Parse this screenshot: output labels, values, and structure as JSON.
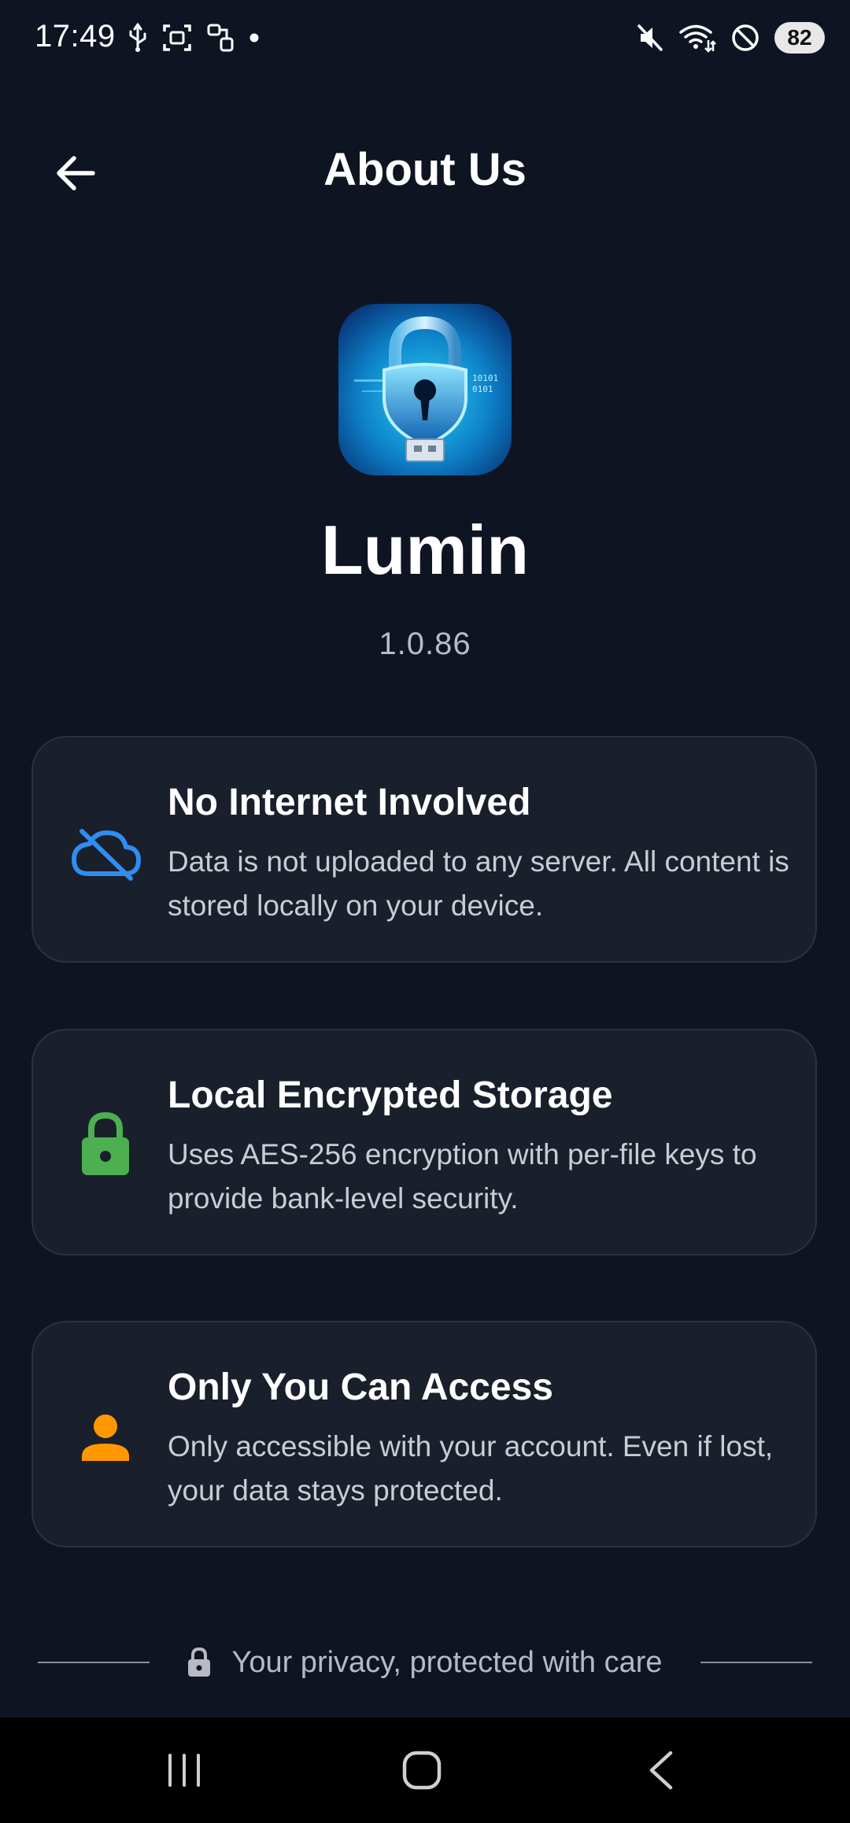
{
  "status_bar": {
    "time": "17:49",
    "battery": "82",
    "left_icons": [
      "usb-icon",
      "screenshot-icon",
      "nfc-icon",
      "dot-icon"
    ],
    "right_icons": [
      "mute-icon",
      "wifi-icon",
      "dnd-icon",
      "battery-icon"
    ]
  },
  "header": {
    "title": "About Us",
    "back_icon": "arrow-back-icon"
  },
  "app": {
    "name": "Lumin",
    "version": "1.0.86",
    "logo_icon": "padlock-shield-usb-logo"
  },
  "features": [
    {
      "title": "No Internet Involved",
      "description": "Data is not uploaded to any server. All content is stored locally on your device.",
      "icon": "cloud-off-icon",
      "color": "#2f8ef0"
    },
    {
      "title": "Local Encrypted Storage",
      "description": "Uses AES-256 encryption with per-file keys to provide bank-level security.",
      "icon": "lock-icon",
      "color": "#4caf50"
    },
    {
      "title": "Only You Can Access",
      "description": "Only accessible with your account. Even if lost, your data stays protected.",
      "icon": "person-icon",
      "color": "#ff9800"
    }
  ],
  "footer": {
    "text": "Your privacy, protected with care",
    "icon": "lock-icon"
  },
  "nav_bar": {
    "buttons": [
      "recents-icon",
      "home-icon",
      "back-icon"
    ]
  },
  "colors": {
    "background": "#0e1421",
    "card_background": "#1a1f2c",
    "card_border": "#2b3140"
  }
}
